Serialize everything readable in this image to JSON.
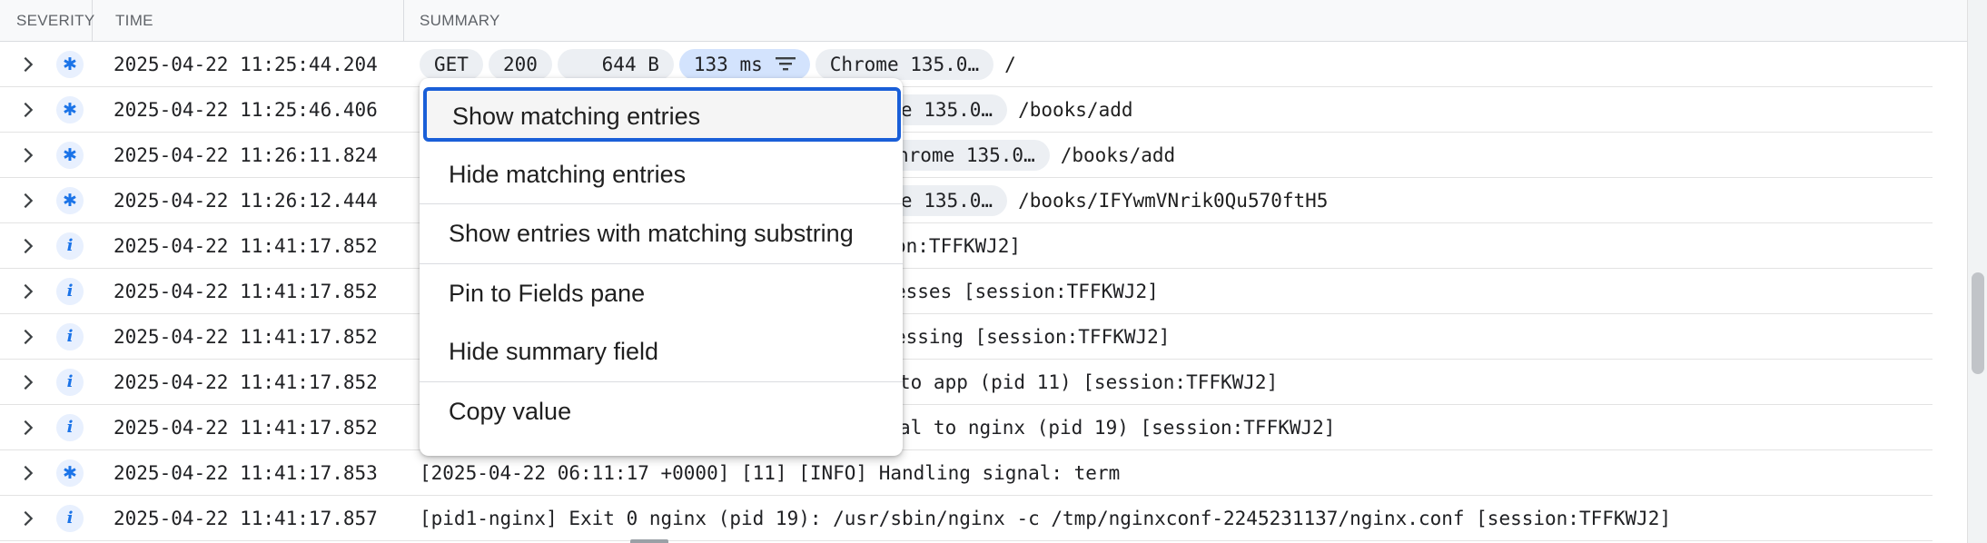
{
  "header": {
    "severity": "SEVERITY",
    "time": "TIME",
    "summary": "SUMMARY"
  },
  "rows": [
    {
      "severity": "default",
      "icon": "asterisk-icon",
      "time": "2025-04-22 11:25:44.204",
      "chips": {
        "method": "GET",
        "status": "200",
        "size": "644 B",
        "latency": "133 ms",
        "browser": "Chrome 135.0…"
      },
      "path": "/"
    },
    {
      "severity": "default",
      "icon": "asterisk-icon",
      "time": "2025-04-22 11:25:46.406",
      "summary": "rome 135.0…",
      "path": "/books/add"
    },
    {
      "severity": "default",
      "icon": "asterisk-icon",
      "time": "2025-04-22 11:26:11.824",
      "summary": "hrome 135.0…",
      "path": "/books/add"
    },
    {
      "severity": "default",
      "icon": "asterisk-icon",
      "time": "2025-04-22 11:26:12.444",
      "summary": "rome 135.0…",
      "path": "/books/IFYwmVNrik0Qu570ftH5"
    },
    {
      "severity": "info",
      "icon": "info-icon",
      "time": "2025-04-22 11:41:17.852",
      "summary": "on:TFFKWJ2]"
    },
    {
      "severity": "info",
      "icon": "info-icon",
      "time": "2025-04-22 11:41:17.852",
      "summary": "esses [session:TFFKWJ2]"
    },
    {
      "severity": "info",
      "icon": "info-icon",
      "time": "2025-04-22 11:41:17.852",
      "summary": "essing [session:TFFKWJ2]"
    },
    {
      "severity": "info",
      "icon": "info-icon",
      "time": "2025-04-22 11:41:17.852",
      "summary": " to app (pid 11) [session:TFFKWJ2]"
    },
    {
      "severity": "info",
      "icon": "info-icon",
      "time": "2025-04-22 11:41:17.852",
      "summary": "al to nginx (pid 19) [session:TFFKWJ2]"
    },
    {
      "severity": "default",
      "icon": "asterisk-icon",
      "time": "2025-04-22 11:41:17.853",
      "summary": "[2025-04-22 06:11:17 +0000] [11] [INFO] Handling signal: term"
    },
    {
      "severity": "info",
      "icon": "info-icon",
      "time": "2025-04-22 11:41:17.857",
      "summary": "[pid1-nginx] Exit 0 nginx (pid 19): /usr/sbin/nginx -c /tmp/nginxconf-2245231137/nginx.conf [session:TFFKWJ2]"
    }
  ],
  "context_menu": {
    "items": [
      {
        "label": "Show matching entries",
        "focused": true
      },
      {
        "label": "Hide matching entries"
      },
      {
        "label": "Show entries with matching substring"
      },
      {
        "label": "Pin to Fields pane"
      },
      {
        "label": "Hide summary field"
      },
      {
        "label": "Copy value"
      }
    ]
  },
  "colors": {
    "accent": "#1a73e8",
    "focus_border": "#1a5fd8",
    "latency_chip": "#d3e3fd",
    "chip": "#eceff3"
  }
}
